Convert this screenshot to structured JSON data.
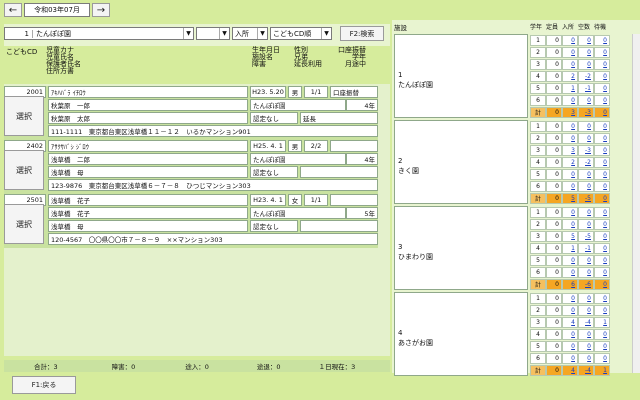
{
  "nav": {
    "prev": "←",
    "next": "→",
    "month": "令和03年07月"
  },
  "filters": {
    "nursery_no": "1",
    "nursery_name": "たんぽぽ園",
    "blank_value": "",
    "status": "入所",
    "order": "こどもCD順",
    "search_button": "F2:検索"
  },
  "list_header": {
    "col1": [
      "こどもCD"
    ],
    "col2": [
      "児童カナ",
      "児童氏名",
      "保護者氏名",
      "住所方書"
    ],
    "col3": [
      "生年月日",
      "施設名",
      "障害"
    ],
    "col4": [
      "性別",
      "兄弟",
      "延長利用"
    ],
    "col5": [
      "口座振替",
      "学年",
      "月途中"
    ]
  },
  "children": [
    {
      "code": "2001",
      "kana": "ｱｷﾊﾊﾞﾗ ｲﾁﾛｳ",
      "birth": "H23. 5.20",
      "sex": "男",
      "sibling": "1/1",
      "account": "口座振替",
      "name": "秋葉原　一郎",
      "facility": "たんぽぽ園",
      "grade": "4年",
      "guardian": "秋葉原　太郎",
      "disability": "認定なし",
      "extension": "延長",
      "address": "111-1111　東京都台東区浅草橋１１－１２　いるかマンション901",
      "select": "選択"
    },
    {
      "code": "2402",
      "kana": "ｱｻｸｻﾊﾞｼ ｼﾞﾛｳ",
      "birth": "H25. 4. 1",
      "sex": "男",
      "sibling": "2/2",
      "account": "",
      "name": "浅草橋　二郎",
      "facility": "たんぽぽ園",
      "grade": "4年",
      "guardian": "浅草橋　母",
      "disability": "認定なし",
      "extension": "",
      "address": "123-9876　東京都台東区浅草橋６－７－８　ひつじマンション303",
      "select": "選択"
    },
    {
      "code": "2501",
      "kana": "浅草橋　花子",
      "birth": "H23. 4. 1",
      "sex": "女",
      "sibling": "1/1",
      "account": "",
      "name": "浅草橋　花子",
      "facility": "たんぽぽ園",
      "grade": "5年",
      "guardian": "浅草橋　母",
      "disability": "認定なし",
      "extension": "",
      "address": "120-4567　〇〇県〇〇市７－８－９　××マンション303",
      "select": "選択"
    }
  ],
  "footer": {
    "total": "合計：3",
    "disabled": "障害：0",
    "transfer_in": "途入：0",
    "transfer_out": "途退：0",
    "today": "１日現在：3",
    "back_button": "F1:戻る"
  },
  "right": {
    "headers": {
      "facility": "施設",
      "grade": "学年",
      "capacity": "定員",
      "enrolled": "入所",
      "vacancy": "空数",
      "waiting": "待機"
    },
    "nurseries": [
      {
        "no": "1",
        "name": "たんぽぽ園",
        "rows": [
          {
            "g": "1",
            "c": "0",
            "e": "0",
            "v": "0",
            "w": "0"
          },
          {
            "g": "2",
            "c": "0",
            "e": "0",
            "v": "0",
            "w": "0"
          },
          {
            "g": "3",
            "c": "0",
            "e": "0",
            "v": "0",
            "w": "0"
          },
          {
            "g": "4",
            "c": "0",
            "e": "2",
            "v": "-2",
            "w": "0"
          },
          {
            "g": "5",
            "c": "0",
            "e": "1",
            "v": "-1",
            "w": "0"
          },
          {
            "g": "6",
            "c": "0",
            "e": "0",
            "v": "0",
            "w": "0"
          },
          {
            "g": "計",
            "c": "0",
            "e": "3",
            "v": "-3",
            "w": "0"
          }
        ]
      },
      {
        "no": "2",
        "name": "きく園",
        "rows": [
          {
            "g": "1",
            "c": "0",
            "e": "0",
            "v": "0",
            "w": "0"
          },
          {
            "g": "2",
            "c": "0",
            "e": "0",
            "v": "0",
            "w": "0"
          },
          {
            "g": "3",
            "c": "0",
            "e": "3",
            "v": "-3",
            "w": "0"
          },
          {
            "g": "4",
            "c": "0",
            "e": "2",
            "v": "-2",
            "w": "0"
          },
          {
            "g": "5",
            "c": "0",
            "e": "0",
            "v": "0",
            "w": "0"
          },
          {
            "g": "6",
            "c": "0",
            "e": "0",
            "v": "0",
            "w": "0"
          },
          {
            "g": "計",
            "c": "0",
            "e": "5",
            "v": "-5",
            "w": "0"
          }
        ]
      },
      {
        "no": "3",
        "name": "ひまわり園",
        "rows": [
          {
            "g": "1",
            "c": "0",
            "e": "0",
            "v": "0",
            "w": "0"
          },
          {
            "g": "2",
            "c": "0",
            "e": "0",
            "v": "0",
            "w": "0"
          },
          {
            "g": "3",
            "c": "0",
            "e": "5",
            "v": "-5",
            "w": "0"
          },
          {
            "g": "4",
            "c": "0",
            "e": "1",
            "v": "-1",
            "w": "0"
          },
          {
            "g": "5",
            "c": "0",
            "e": "0",
            "v": "0",
            "w": "0"
          },
          {
            "g": "6",
            "c": "0",
            "e": "0",
            "v": "0",
            "w": "0"
          },
          {
            "g": "計",
            "c": "0",
            "e": "6",
            "v": "-6",
            "w": "0"
          }
        ]
      },
      {
        "no": "4",
        "name": "あさがお園",
        "rows": [
          {
            "g": "1",
            "c": "0",
            "e": "0",
            "v": "0",
            "w": "0"
          },
          {
            "g": "2",
            "c": "0",
            "e": "0",
            "v": "0",
            "w": "0"
          },
          {
            "g": "3",
            "c": "0",
            "e": "4",
            "v": "-4",
            "w": "1"
          },
          {
            "g": "4",
            "c": "0",
            "e": "0",
            "v": "0",
            "w": "0"
          },
          {
            "g": "5",
            "c": "0",
            "e": "0",
            "v": "0",
            "w": "0"
          },
          {
            "g": "6",
            "c": "0",
            "e": "0",
            "v": "0",
            "w": "0"
          },
          {
            "g": "計",
            "c": "0",
            "e": "4",
            "v": "-4",
            "w": "1"
          }
        ]
      }
    ]
  }
}
